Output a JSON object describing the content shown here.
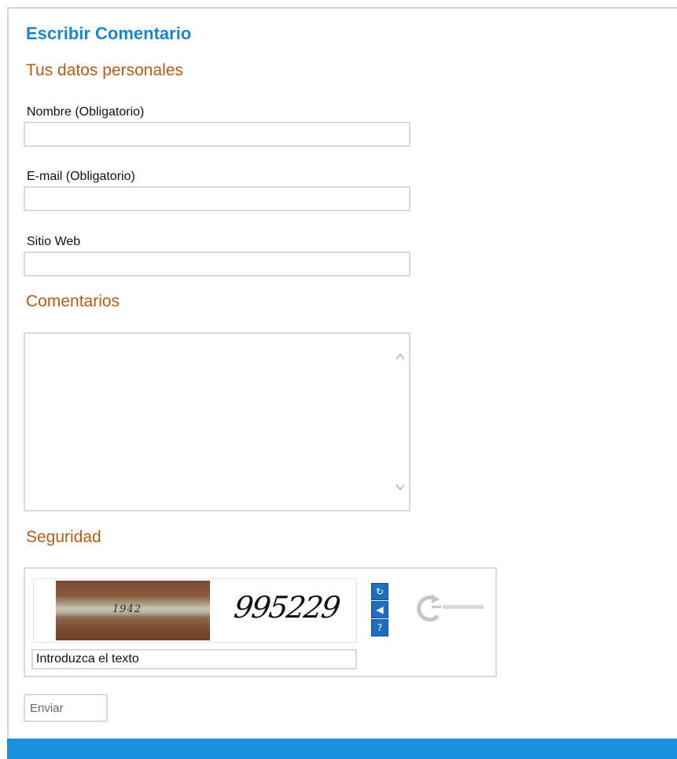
{
  "form": {
    "title": "Escribir Comentario",
    "personal_section": "Tus datos personales",
    "name_label": "Nombre (Obligatorio)",
    "name_value": "",
    "email_label": "E-mail (Obligatorio)",
    "email_value": "",
    "website_label": "Sitio Web",
    "website_value": "",
    "comments_section": "Comentarios",
    "comments_value": "",
    "security_section": "Seguridad",
    "submit_label": "Enviar"
  },
  "captcha": {
    "photo_number": "1942",
    "word": "995229",
    "input_value": "Introduzca el texto",
    "controls": [
      {
        "icon": "refresh-icon",
        "glyph": "↻"
      },
      {
        "icon": "audio-icon",
        "glyph": "◀"
      },
      {
        "icon": "help-icon",
        "glyph": "?"
      }
    ],
    "logo": "reCAPTCHA-logo"
  },
  "colors": {
    "title": "#1a86cf",
    "section": "#b85a12",
    "border": "#d9d9d9",
    "footer": "#1a90de",
    "captcha_button": "#1e6fc2"
  }
}
